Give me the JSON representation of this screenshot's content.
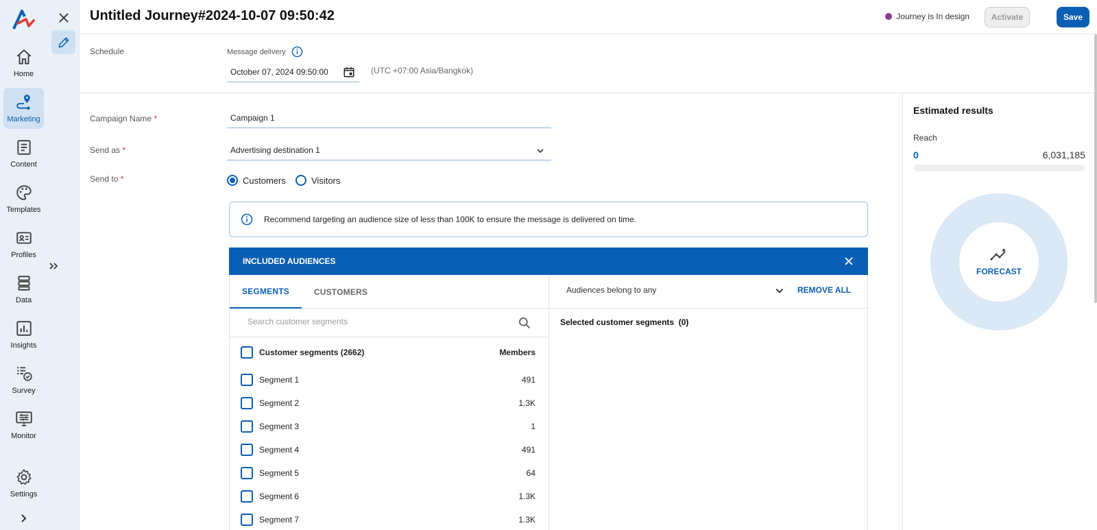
{
  "nav": {
    "items": [
      {
        "label": "Home",
        "icon": "home-icon"
      },
      {
        "label": "Marketing",
        "icon": "journey-pin-icon"
      },
      {
        "label": "Content",
        "icon": "document-icon"
      },
      {
        "label": "Templates",
        "icon": "palette-icon"
      },
      {
        "label": "Profiles",
        "icon": "id-card-icon"
      },
      {
        "label": "Data",
        "icon": "database-icon"
      },
      {
        "label": "Insights",
        "icon": "bar-chart-icon"
      },
      {
        "label": "Survey",
        "icon": "survey-check-icon"
      },
      {
        "label": "Monitor",
        "icon": "monitor-sliders-icon"
      },
      {
        "label": "Settings",
        "icon": "gear-icon"
      }
    ],
    "active": "Marketing",
    "accent_color": "#0a5fb4"
  },
  "header": {
    "title": "Untitled Journey#2024-10-07 09:50:42",
    "status": "Journey is In design",
    "status_color": "#8e3a8e",
    "activate_label": "Activate",
    "save_label": "Save"
  },
  "schedule": {
    "label": "Schedule",
    "delivery_label": "Message delivery",
    "date_value": "October 07, 2024 09:50:00",
    "timezone": "(UTC +07:00 Asia/Bangkok)"
  },
  "form": {
    "campaign_name_label": "Campaign Name",
    "campaign_name_value": "Campaign 1",
    "send_as_label": "Send as",
    "send_as_value": "Advertising destination 1",
    "send_to_label": "Send to",
    "required_mark": "*",
    "send_to_options": [
      {
        "label": "Customers",
        "selected": true
      },
      {
        "label": "Visitors",
        "selected": false
      }
    ]
  },
  "info": {
    "message": "Recommend targeting an audience size of less than 100K to ensure the message is delivered on time."
  },
  "audiences": {
    "title": "INCLUDED AUDIENCES",
    "tabs": [
      {
        "label": "SEGMENTS",
        "active": true
      },
      {
        "label": "CUSTOMERS",
        "active": false
      }
    ],
    "search_placeholder": "Search customer segments",
    "list_header": {
      "name": "Customer segments (2662)",
      "members": "Members"
    },
    "segments": [
      {
        "name": "Segment 1",
        "members": "491"
      },
      {
        "name": "Segment 2",
        "members": "1.3K"
      },
      {
        "name": "Segment 3",
        "members": "1"
      },
      {
        "name": "Segment 4",
        "members": "491"
      },
      {
        "name": "Segment 5",
        "members": "64"
      },
      {
        "name": "Segment 6",
        "members": "1.3K"
      },
      {
        "name": "Segment 7",
        "members": "1.3K"
      }
    ],
    "belong_label": "Audiences belong to any",
    "remove_all_label": "REMOVE ALL",
    "selected_label": "Selected customer segments",
    "selected_count": "(0)"
  },
  "estimate": {
    "title": "Estimated results",
    "reach_label": "Reach",
    "reach_value": "0",
    "reach_total": "6,031,185",
    "reach_fraction": 0,
    "forecast_label": "FORECAST"
  }
}
